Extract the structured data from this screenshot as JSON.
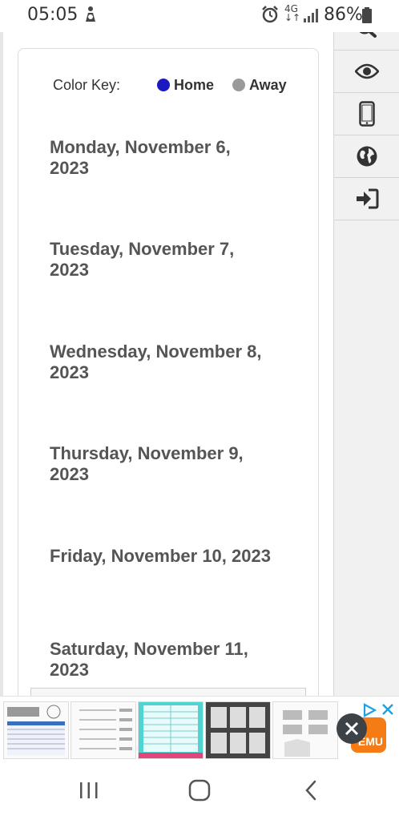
{
  "status_bar": {
    "time": "05:05",
    "network_label": "4G",
    "battery": "86%",
    "icons": [
      "person-notification-icon",
      "alarm-icon",
      "data-arrows-icon",
      "signal-icon",
      "battery-icon"
    ]
  },
  "color_key": {
    "label": "Color Key:",
    "home": "Home",
    "away": "Away",
    "home_color": "#1a1ac0",
    "away_color": "#9a9a9a"
  },
  "days": [
    {
      "line1": "Monday, November 6,",
      "line2": "2023"
    },
    {
      "line1": "Tuesday, November 7,",
      "line2": "2023"
    },
    {
      "line1": "Wednesday, November 8,",
      "line2": "2023"
    },
    {
      "line1": "Thursday, November 9,",
      "line2": "2023"
    },
    {
      "line1": "Friday, November 10, 2023",
      "line2": ""
    },
    {
      "line1": "Saturday, November 11,",
      "line2": "2023"
    }
  ],
  "sidebar": {
    "buttons": [
      "search-icon",
      "eye-icon",
      "mobile-phone-icon",
      "globe-icon",
      "sign-in-icon"
    ]
  },
  "ad": {
    "brand": "EMU",
    "thumbnails": 5
  },
  "navbar": {
    "buttons": [
      "recent-apps-icon",
      "home-icon",
      "back-icon"
    ]
  }
}
